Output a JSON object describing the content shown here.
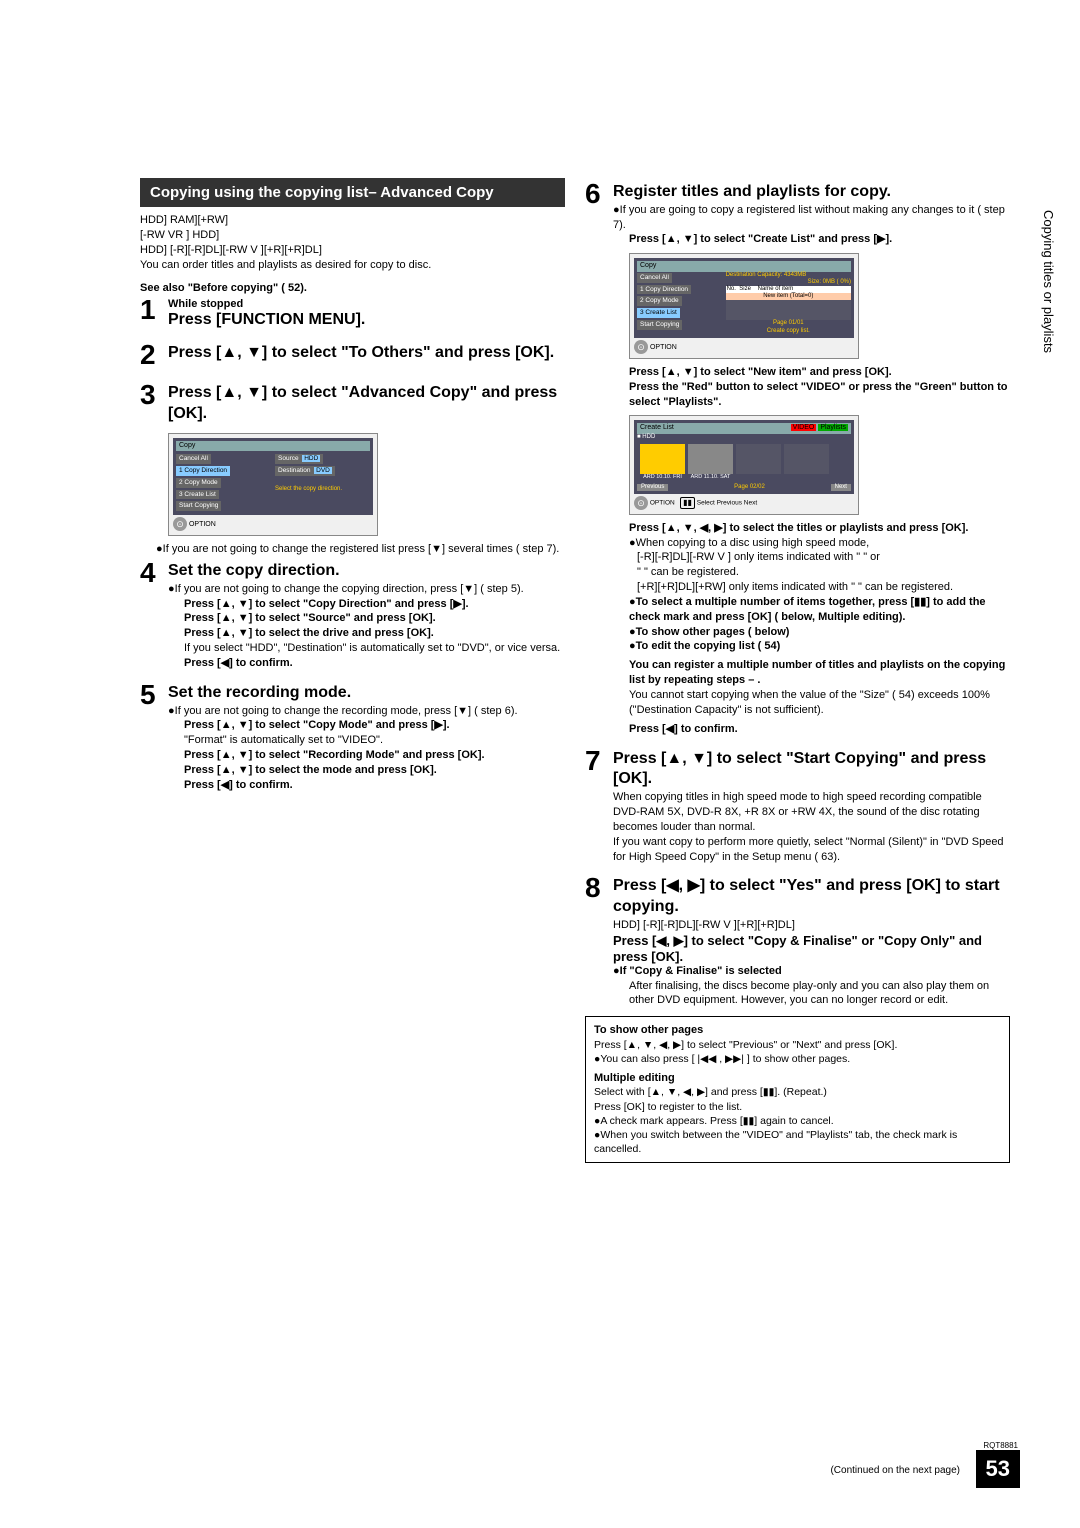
{
  "section_header": "Copying using the copying list– Advanced Copy",
  "format_line1": "HDD]      RAM][+RW]",
  "format_line2": "[-RW VR ]     HDD]",
  "format_line3": "HDD]    [-R][-R]DL][-RW V ][+R][+R]DL]",
  "format_line4": "You can order titles and playlists as desired for copy to disc.",
  "see_also": "See also \"Before copying\" (    52).",
  "step1_label": "1",
  "step1_sub": "While stopped",
  "step1_title": "Press [FUNCTION MENU].",
  "step2_label": "2",
  "step2_title": "Press [▲, ▼] to select \"To Others\" and press [OK].",
  "step3_label": "3",
  "step3_title": "Press [▲, ▼] to select \"Advanced Copy\" and press [OK].",
  "step3_note": "●If you are not going to change the registered list press [▼] several times (    step 7).",
  "step4_label": "4",
  "step4_title": "Set the copy direction.",
  "step4_bullet": "●If you are not going to change the copying direction, press [▼] (    step 5).",
  "step4_l1": "Press [▲, ▼] to select \"Copy Direction\" and press [▶].",
  "step4_l2": "Press [▲, ▼] to select \"Source\" and press [OK].",
  "step4_l3": "Press [▲, ▼] to select the drive and press [OK].",
  "step4_l4": "If you select \"HDD\", \"Destination\" is automatically set to \"DVD\", or vice versa.",
  "step4_l5": "Press [◀] to confirm.",
  "step5_label": "5",
  "step5_title": "Set the recording mode.",
  "step5_bullet": "●If you are not going to change the recording mode, press [▼] (    step 6).",
  "step5_l1": "Press [▲, ▼] to select \"Copy Mode\" and press [▶].",
  "step5_l2": "\"Format\" is automatically set to \"VIDEO\".",
  "step5_l3": "Press [▲, ▼] to select \"Recording Mode\" and press [OK].",
  "step5_l4": "Press [▲, ▼] to select the mode and press [OK].",
  "step5_l5": "Press [◀] to confirm.",
  "step6_label": "6",
  "step6_title": "Register titles and playlists for copy.",
  "step6_bullet": "●If you are going to copy a registered list without making any changes to it (    step 7).",
  "step6_l1": "Press [▲, ▼] to select \"Create List\" and press [▶].",
  "step6_l2": "Press [▲, ▼] to select \"New item\" and press [OK].",
  "step6_l3": "Press the \"Red\" button to select \"VIDEO\" or press the \"Green\" button to select \"Playlists\".",
  "step6_l4": "Press [▲, ▼, ◀, ▶] to select the titles or playlists and press [OK].",
  "step6_l5": "●When copying to a disc using high speed mode,",
  "step6_l6": "[-R][-R]DL][-RW V ] only items indicated with \"        \" or",
  "step6_l7": "\"        \" can be registered.",
  "step6_l8": "[+R][+R]DL][+RW] only items indicated with \"        \" can be registered.",
  "step6_l9": "●To select a multiple number of items together, press [▮▮] to add the check mark and press [OK] (    below, Multiple editing).",
  "step6_l10": "●To show other pages (    below)",
  "step6_l11": "●To edit the copying list (    54)",
  "step6_l12": "You can register a multiple number of titles and playlists on the copying list by repeating steps    –   .",
  "step6_l13": "You cannot start copying when the value of the \"Size\" (    54) exceeds 100% (\"Destination Capacity\" is not sufficient).",
  "step6_l14": "Press [◀] to confirm.",
  "step7_label": "7",
  "step7_title": "Press [▲, ▼] to select \"Start Copying\" and press [OK].",
  "step7_body1": "When copying titles in high speed mode to high speed recording compatible DVD-RAM 5X, DVD-R 8X, +R 8X or +RW 4X, the sound of the disc rotating becomes louder than normal.",
  "step7_body2": "If you want copy to perform more quietly, select \"Normal (Silent)\" in \"DVD Speed for High Speed Copy\" in the Setup menu (    63).",
  "step8_label": "8",
  "step8_title": "Press [◀, ▶] to select \"Yes\" and press [OK] to start copying.",
  "step8_sub1": "HDD]    [-R][-R]DL][-RW V ][+R][+R]DL]",
  "step8_l1": "Press [◀, ▶] to select \"Copy & Finalise\" or \"Copy Only\" and press [OK].",
  "step8_l2": "●If \"Copy & Finalise\" is selected",
  "step8_l3": "After finalising, the discs become play-only and you can also play them on other DVD equipment. However, you can no longer record or edit.",
  "info_h1": "To show other pages",
  "info_l1": "Press [▲, ▼, ◀, ▶] to select \"Previous\" or \"Next\" and press [OK].",
  "info_l2": "●You can also press [ |◀◀ , ▶▶| ] to show other pages.",
  "info_h2": "Multiple editing",
  "info_l3": "Select with [▲, ▼, ◀, ▶] and press [▮▮]. (Repeat.)",
  "info_l4": "Press [OK] to register to the list.",
  "info_l5": "●A check mark appears. Press [▮▮] again to cancel.",
  "info_l6": "●When you switch between the \"VIDEO\" and \"Playlists\" tab, the check mark is cancelled.",
  "right_tab": "Copying titles or playlists",
  "footer_note": "(Continued on the next page)",
  "rqt": "RQT8881",
  "page_num": "53",
  "osd": {
    "copy": "Copy",
    "cancel_all": "Cancel All",
    "copy_dir": "1 Copy Direction",
    "copy_mode": "2 Copy Mode",
    "create_list": "3 Create List",
    "start_copy": "Start Copying",
    "source": "Source",
    "dest": "Destination",
    "hdd": "HDD",
    "dvd": "DVD",
    "select_dir": "Select the copy direction.",
    "option": "OPTION",
    "dest_cap": "Destination Capacity: 4343MB",
    "size": "Size:    0MB ( 0%)",
    "no": "No.",
    "sz": "Size",
    "name": "Name of item",
    "new_item": "New item (Total=0)",
    "page": "Page 01/01",
    "create_copy_list": "Create copy list.",
    "create_list2": "Create List",
    "video_tab": "VIDEO",
    "playlists_tab": "Playlists",
    "previous": "Previous",
    "page2": "Page 02/02",
    "next": "Next",
    "select": "Select",
    "prev_next": "Previous   Next",
    "ard1": "ARD 10.10. FRI",
    "ard2": "ARD 11.10. SAT"
  }
}
